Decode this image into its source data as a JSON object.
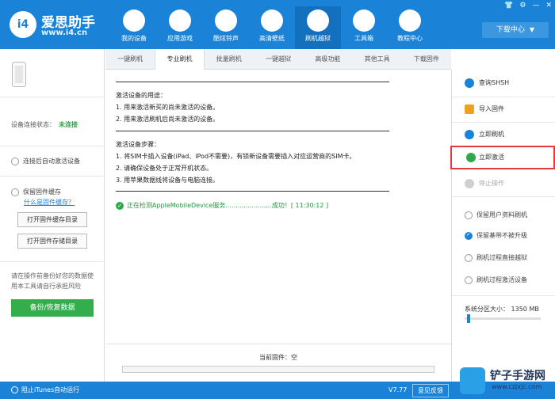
{
  "app": {
    "brand_name": "爱思助手",
    "brand_url": "www.i4.cn",
    "brand_badge": "i4",
    "accent": "#1a83d8"
  },
  "window_controls": [
    "👕",
    "⚙",
    "—",
    "✕"
  ],
  "nav": [
    {
      "label": "我的设备",
      "icon": "apple-icon",
      "glyph": ""
    },
    {
      "label": "应用游戏",
      "icon": "app-store-icon",
      "glyph": "A"
    },
    {
      "label": "酷炫铃声",
      "icon": "bell-icon",
      "glyph": "🔔"
    },
    {
      "label": "高清壁纸",
      "icon": "gear-flower-icon",
      "glyph": "✿"
    },
    {
      "label": "刷机越狱",
      "icon": "dropbox-icon",
      "glyph": "❖"
    },
    {
      "label": "工具箱",
      "icon": "tools-icon",
      "glyph": "✖"
    },
    {
      "label": "教程中心",
      "icon": "info-icon",
      "glyph": "i"
    }
  ],
  "download_center": "下载中心",
  "left": {
    "status_label": "设备连接状态：",
    "status_value": "未连接",
    "auto_activate": "连接后自动激活设备",
    "keep_firmware": "保留固件缓存",
    "what_is_cache": "什么是固件缓存？",
    "open_cache_dir": "打开固件缓存目录",
    "open_storage_dir": "打开固件存储目录",
    "warning": "请在操作前备份好您的数据使用本工具请自行承担风险",
    "backup_button": "备份/恢复数据"
  },
  "tabs": [
    "一键刷机",
    "专业刷机",
    "批量刷机",
    "一键越狱",
    "高级功能",
    "其他工具",
    "下载固件"
  ],
  "active_tab": 1,
  "content": {
    "purpose_title": "激活设备的用途：",
    "purpose_1": "1. 用来激活新买的尚未激活的设备。",
    "purpose_2": "2. 用来激活刷机后尚未激活的设备。",
    "steps_title": "激活设备步骤：",
    "step_1": "1. 将SIM卡插入设备(iPad、iPod不需要)，有锁新设备需要插入对应运营商的SIM卡。",
    "step_2": "2. 请确保设备处于正常开机状态。",
    "step_3": "3. 用苹果数据线将设备与电脑连接。",
    "detect_line": "正在检测AppleMobileDevice服务.......................成功！[ 11:30:12 ]",
    "firmware_label": "当前固件：空",
    "progress": 0
  },
  "right": {
    "query_shsh": "查询SHSH",
    "import_firmware": "导入固件",
    "flash_now": "立即刷机",
    "activate_now": "立即激活",
    "stop": "停止操作",
    "opt_keep_user_data": "保留用户资料刷机",
    "opt_keep_baseband": "保留基带不被升级",
    "opt_jailbreak": "刷机过程直接越狱",
    "opt_activate": "刷机过程激活设备",
    "partition": "系统分区大小：  1350 MB"
  },
  "bottom": {
    "itunes": "阻止iTunes自动运行",
    "version": "V7.77",
    "feedback": "意见反馈"
  },
  "watermark": {
    "title": "铲子手游网",
    "url": "www.czjxjc.com"
  }
}
